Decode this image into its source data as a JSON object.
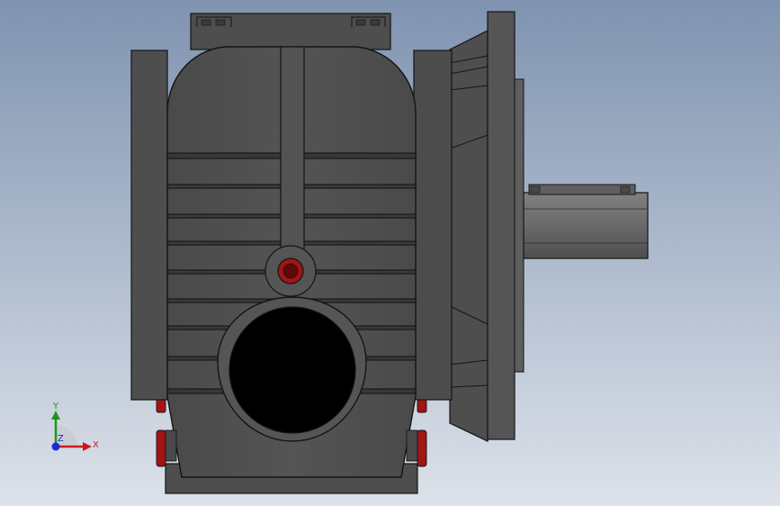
{
  "colors": {
    "background_top": "#7f93b0",
    "background_bottom": "#dde2ea",
    "housing": "#505050",
    "housing_dark": "#3c3c3c",
    "housing_light": "#6a6a6a",
    "edge": "#141414",
    "flange": "#5a5a5a",
    "shaft": "#6e6e6e",
    "bolt_red": "#a31414",
    "bolt_red_dark": "#5e0808",
    "bore": "#000000",
    "axis_x": "#c81a1a",
    "axis_y": "#1a9a1a",
    "axis_z": "#1a2ad8"
  },
  "triad": {
    "x_label": "X",
    "y_label": "Y",
    "z_label": "Z"
  }
}
